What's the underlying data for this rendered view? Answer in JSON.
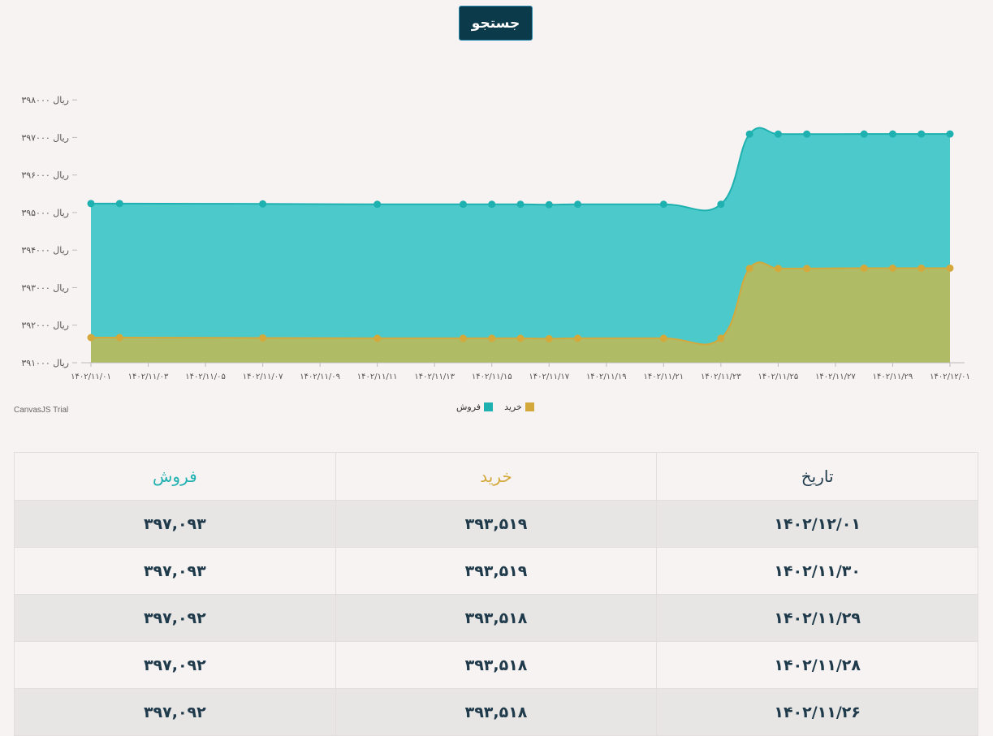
{
  "search": {
    "label": "جستجو"
  },
  "colors": {
    "sell": "#4ccacb",
    "sell_line": "#1fb0b0",
    "buy": "#b0bb66",
    "buy_line": "#d4a93c",
    "header_bg": "#0b3a4b"
  },
  "chart_data": {
    "type": "area",
    "y_axis": {
      "ticks": [
        391000,
        392000,
        393000,
        394000,
        395000,
        396000,
        397000,
        398000
      ],
      "tick_labels": [
        "ریال ۳۹۱۰۰۰",
        "ریال ۳۹۲۰۰۰",
        "ریال ۳۹۳۰۰۰",
        "ریال ۳۹۴۰۰۰",
        "ریال ۳۹۵۰۰۰",
        "ریال ۳۹۶۰۰۰",
        "ریال ۳۹۷۰۰۰",
        "ریال ۳۹۸۰۰۰"
      ],
      "ylim": [
        391000,
        398500
      ]
    },
    "x_axis": {
      "tick_days": [
        0,
        2,
        4,
        6,
        8,
        10,
        12,
        14,
        16,
        18,
        20,
        22,
        24,
        26,
        28,
        30
      ],
      "tick_labels": [
        "۱۴۰۲/۱۱/۰۱",
        "۱۴۰۲/۱۱/۰۳",
        "۱۴۰۲/۱۱/۰۵",
        "۱۴۰۲/۱۱/۰۷",
        "۱۴۰۲/۱۱/۰۹",
        "۱۴۰۲/۱۱/۱۱",
        "۱۴۰۲/۱۱/۱۳",
        "۱۴۰۲/۱۱/۱۵",
        "۱۴۰۲/۱۱/۱۷",
        "۱۴۰۲/۱۱/۱۹",
        "۱۴۰۲/۱۱/۲۱",
        "۱۴۰۲/۱۱/۲۳",
        "۱۴۰۲/۱۱/۲۵",
        "۱۴۰۲/۱۱/۲۷",
        "۱۴۰۲/۱۱/۲۹",
        "۱۴۰۲/۱۲/۰۱"
      ]
    },
    "x": [
      0,
      1,
      6,
      10,
      13,
      14,
      15,
      16,
      17,
      20,
      22,
      23,
      24,
      25,
      27,
      28,
      29,
      30
    ],
    "series": [
      {
        "name": "فروش",
        "values": [
          395240,
          395240,
          395230,
          395220,
          395220,
          395220,
          395220,
          395210,
          395220,
          395220,
          395220,
          397090,
          397090,
          397090,
          397092,
          397092,
          397093,
          397093
        ]
      },
      {
        "name": "خرید",
        "values": [
          391670,
          391670,
          391660,
          391650,
          391650,
          391650,
          391650,
          391640,
          391650,
          391650,
          391650,
          393510,
          393510,
          393510,
          393518,
          393518,
          393519,
          393519
        ]
      }
    ],
    "legend": "bottom-center",
    "grid": false
  },
  "trial_text": "CanvasJS Trial",
  "legend_labels": {
    "sell": "فروش",
    "buy": "خرید"
  },
  "table": {
    "headers": {
      "date": "تاریخ",
      "buy": "خرید",
      "sell": "فروش"
    },
    "header_colors": {
      "date": "#1f3a4a",
      "buy": "#d4a93c",
      "sell": "#1fb0b0"
    },
    "rows": [
      {
        "date": "۱۴۰۲/۱۲/۰۱",
        "buy": "۳۹۳,۵۱۹",
        "sell": "۳۹۷,۰۹۳"
      },
      {
        "date": "۱۴۰۲/۱۱/۳۰",
        "buy": "۳۹۳,۵۱۹",
        "sell": "۳۹۷,۰۹۳"
      },
      {
        "date": "۱۴۰۲/۱۱/۲۹",
        "buy": "۳۹۳,۵۱۸",
        "sell": "۳۹۷,۰۹۲"
      },
      {
        "date": "۱۴۰۲/۱۱/۲۸",
        "buy": "۳۹۳,۵۱۸",
        "sell": "۳۹۷,۰۹۲"
      },
      {
        "date": "۱۴۰۲/۱۱/۲۶",
        "buy": "۳۹۳,۵۱۸",
        "sell": "۳۹۷,۰۹۲"
      }
    ]
  }
}
